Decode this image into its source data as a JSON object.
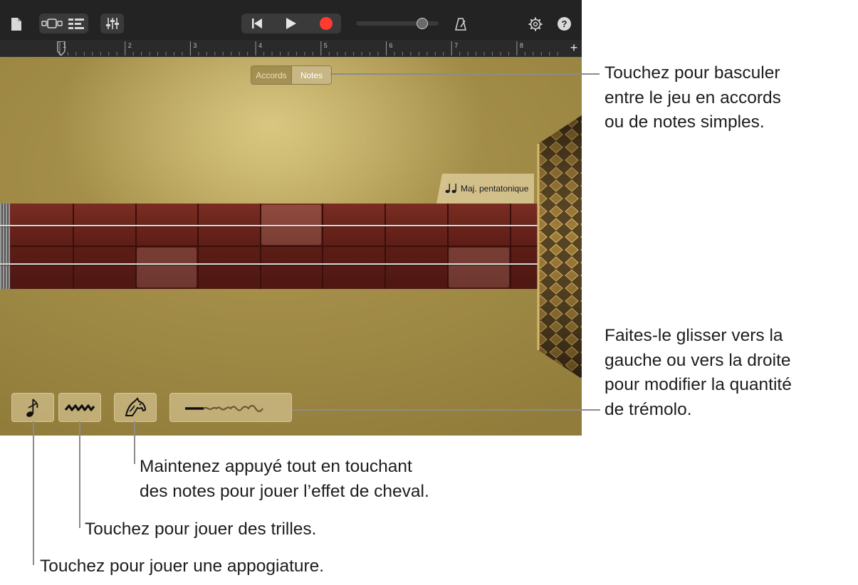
{
  "toolbar": {
    "icons": [
      "document-icon",
      "view-toggle-icon",
      "tracks-view-icon",
      "mixer-icon",
      "go-to-start-icon",
      "play-icon",
      "record-icon",
      "volume-slider",
      "metronome-icon",
      "settings-icon",
      "help-icon"
    ],
    "help_label": "?",
    "add_label": "+",
    "colors": {
      "record": "#ff3b30",
      "bar": "#232323"
    }
  },
  "ruler": {
    "bars": [
      "1",
      "2",
      "3",
      "4",
      "5",
      "6",
      "7",
      "8"
    ]
  },
  "mode_switch": {
    "options": [
      "Accords",
      "Notes"
    ],
    "selected": "Notes"
  },
  "scale": {
    "icon": "music-notes-icon",
    "label": "Maj. pentatonique"
  },
  "controls": {
    "grace_note": {
      "icon": "grace-note-icon"
    },
    "trill": {
      "icon": "trill-icon"
    },
    "horse": {
      "icon": "horse-icon"
    },
    "tremolo": {
      "icon": "tremolo-slider-icon"
    }
  },
  "callouts": {
    "toggle": "Touchez pour basculer\nentre le jeu en accords\nou de notes simples.",
    "tremolo": "Faites-le glisser vers la\ngauche ou vers la droite\npour modifier la quantité\nde trémolo.",
    "horse": "Maintenez appuyé tout en touchant\ndes notes pour jouer l’effet de cheval.",
    "trill": "Touchez pour jouer des trilles.",
    "grace": "Touchez pour jouer une appogiature."
  }
}
